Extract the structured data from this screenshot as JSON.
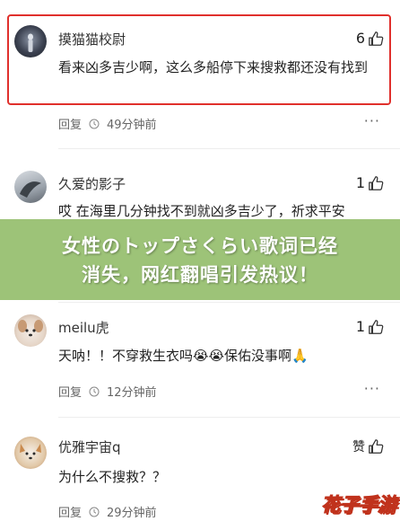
{
  "comments": [
    {
      "user": "摸猫猫校尉",
      "likes": "6",
      "text": "看来凶多吉少啊，这么多船停下来搜救都还没有找到",
      "reply": "回复",
      "time": "49分钟前"
    },
    {
      "user": "久爱的影子",
      "likes": "1",
      "text": "哎 在海里几分钟找不到就凶多吉少了，祈求平安",
      "reply": "回复",
      "time": ""
    },
    {
      "user": "meilu虎",
      "likes": "1",
      "text": "天呐！！不穿救生衣吗😭😭保佑没事啊🙏",
      "reply": "回复",
      "time": "12分钟前"
    },
    {
      "user": "优雅宇宙q",
      "likes": "赞",
      "text": "为什么不搜救？？",
      "reply": "回复",
      "time": "29分钟前"
    }
  ],
  "banner": {
    "line1": "女性のトップさくらい歌词已经",
    "line2": "消失，网红翻唱引发热议！"
  },
  "watermark": "花子手游",
  "more_label": "···",
  "colors": {
    "highlight": "#e0302c",
    "banner": "#96be6e",
    "watermark": "#f6d23a"
  }
}
